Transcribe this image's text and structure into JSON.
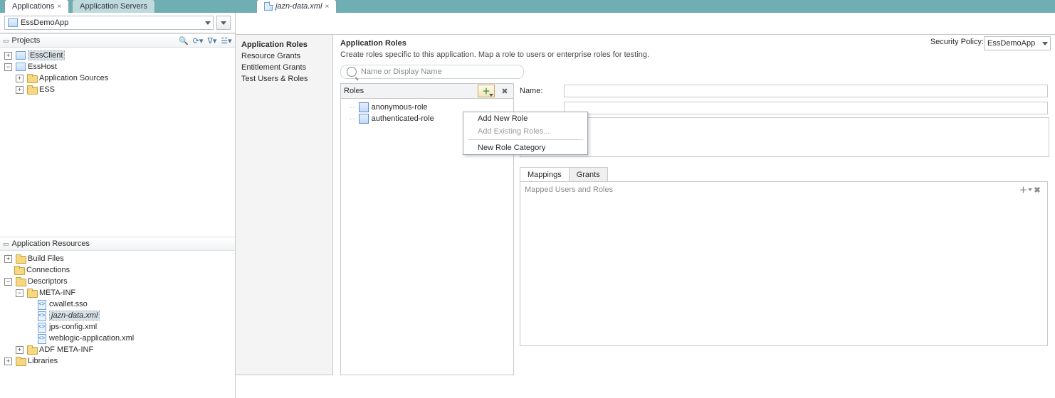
{
  "tabs_left": [
    {
      "label": "Applications",
      "active": true,
      "closable": true
    },
    {
      "label": "Application Servers",
      "active": false,
      "closable": false
    }
  ],
  "doc_tab": {
    "label": "jazn-data.xml"
  },
  "app_selector": {
    "value": "EssDemoApp"
  },
  "projects": {
    "header": "Projects",
    "nodes": [
      "EssClient",
      "EssHost",
      "Application Sources",
      "ESS"
    ]
  },
  "app_resources": {
    "header": "Application Resources",
    "nodes": [
      "Build Files",
      "Connections",
      "Descriptors",
      "META-INF",
      "cwallet.sso",
      "jazn-data.xml",
      "jps-config.xml",
      "weblogic-application.xml",
      "ADF META-INF",
      "Libraries"
    ]
  },
  "editor_nav": [
    "Application Roles",
    "Resource Grants",
    "Entitlement Grants",
    "Test Users & Roles"
  ],
  "editor": {
    "title": "Application Roles",
    "desc": "Create roles specific to this application. Map a role to users or enterprise roles for testing.",
    "search_placeholder": "Name or Display Name",
    "security_policy_label": "Security Policy:",
    "security_policy_value": "EssDemoApp",
    "roles_header": "Roles",
    "roles": [
      "anonymous-role",
      "authenticated-role"
    ],
    "name_label": "Name:",
    "sub_tabs": [
      "Mappings",
      "Grants"
    ],
    "map_placeholder": "Mapped Users and Roles"
  },
  "popup": [
    {
      "label": "Add New Role",
      "disabled": false
    },
    {
      "label": "Add Existing Roles...",
      "disabled": true
    },
    {
      "sep": true
    },
    {
      "label": "New Role Category",
      "disabled": false
    }
  ]
}
